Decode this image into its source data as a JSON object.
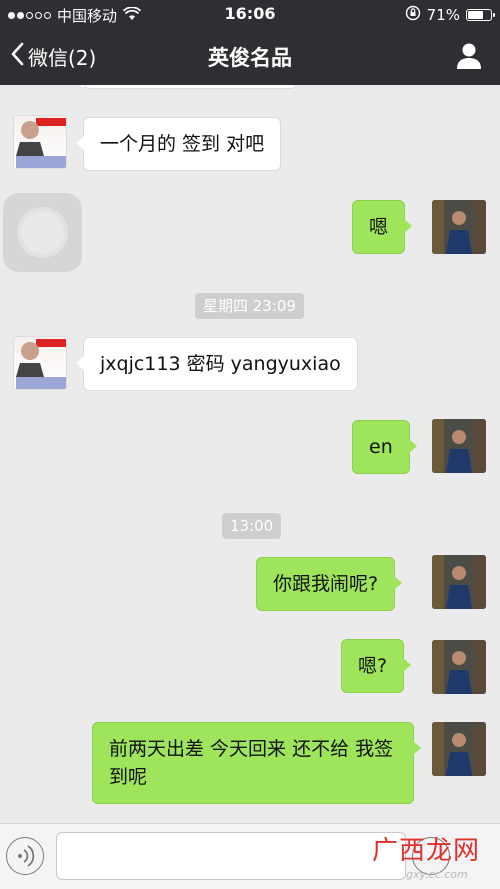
{
  "status_bar": {
    "carrier": "中国移动",
    "time": "16:06",
    "battery": "71%",
    "battery_level": 0.71,
    "signal_bars_on": 2,
    "signal_bars_total": 5
  },
  "nav": {
    "back_label": "微信(2)",
    "title": "英俊名品"
  },
  "messages": [
    {
      "from": "them",
      "text": "一个月的 签到 对吧"
    },
    {
      "from": "me",
      "text": "嗯"
    },
    {
      "from": "me",
      "text": "en"
    },
    {
      "from": "them",
      "text": "jxqjc113  密码 yangyuxiao"
    },
    {
      "from": "me",
      "text": "你跟我闹呢?"
    },
    {
      "from": "me",
      "text": "嗯?"
    },
    {
      "from": "me",
      "text": "前两天出差  今天回来 还不给 我签到呢"
    }
  ],
  "time_separators": [
    "星期四 23:09",
    "13:00"
  ],
  "input": {
    "placeholder": "",
    "value": ""
  },
  "watermark": {
    "text": "广西龙网",
    "url": "gxy.cc.com"
  },
  "colors": {
    "bar": "#2f2f33",
    "bubble_out": "#9ee55b",
    "bubble_in": "#ffffff",
    "chat_bg": "#ebebeb"
  },
  "icons": [
    "back-chevron-icon",
    "contact-profile-icon",
    "wifi-icon",
    "lock-rotation-icon",
    "voice-icon",
    "emoji-icon",
    "assistive-touch-icon"
  ]
}
